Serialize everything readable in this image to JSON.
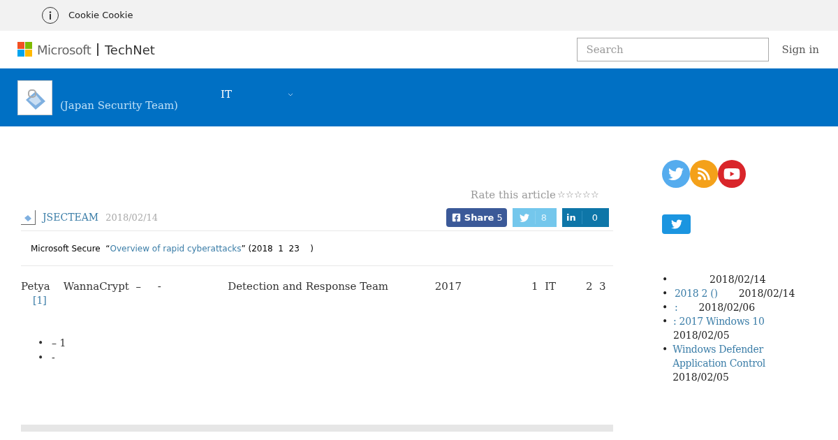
{
  "cookie_bar": {
    "text": "Cookie Cookie"
  },
  "header": {
    "brand": "Microsoft",
    "product": "TechNet",
    "search": {
      "placeholder": "Search"
    },
    "sign_in": "Sign in"
  },
  "blog_banner": {
    "subtitle": "(Japan Security Team)",
    "nav_label": "IT"
  },
  "article": {
    "rating": {
      "label": "Rate this article",
      "stars": 0
    },
    "author": "JSECTEAM",
    "date": "2018/02/14",
    "share": [
      {
        "kind": "facebook",
        "label": "Share",
        "count": "5"
      },
      {
        "kind": "twitter",
        "count": "8"
      },
      {
        "kind": "linkedin",
        "label": "in",
        "count": "0"
      }
    ],
    "intro": {
      "before": "Microsoft Secure  “",
      "link": "Overview of rapid cyberattacks",
      "after": "” (2018  1  23    )"
    },
    "body": "Petya    WannaCrypt  –     -                    Detection and Response Team              2017                     1  IT         2  3",
    "footnote": "[1]",
    "bullet_marker": "•",
    "bullets": [
      "– 1",
      "-"
    ]
  },
  "sidebar": {
    "bullet_marker": "•",
    "posts": [
      {
        "date": "2018/02/14"
      },
      {
        "title": "2018  2  ()",
        "date": "2018/02/14"
      },
      {
        "title": ":",
        "date": "2018/02/06"
      },
      {
        "title": ": 2017  Windows 10",
        "date": "2018/02/05"
      },
      {
        "title": "Windows Defender Application Control",
        "date": "2018/02/05"
      }
    ]
  }
}
